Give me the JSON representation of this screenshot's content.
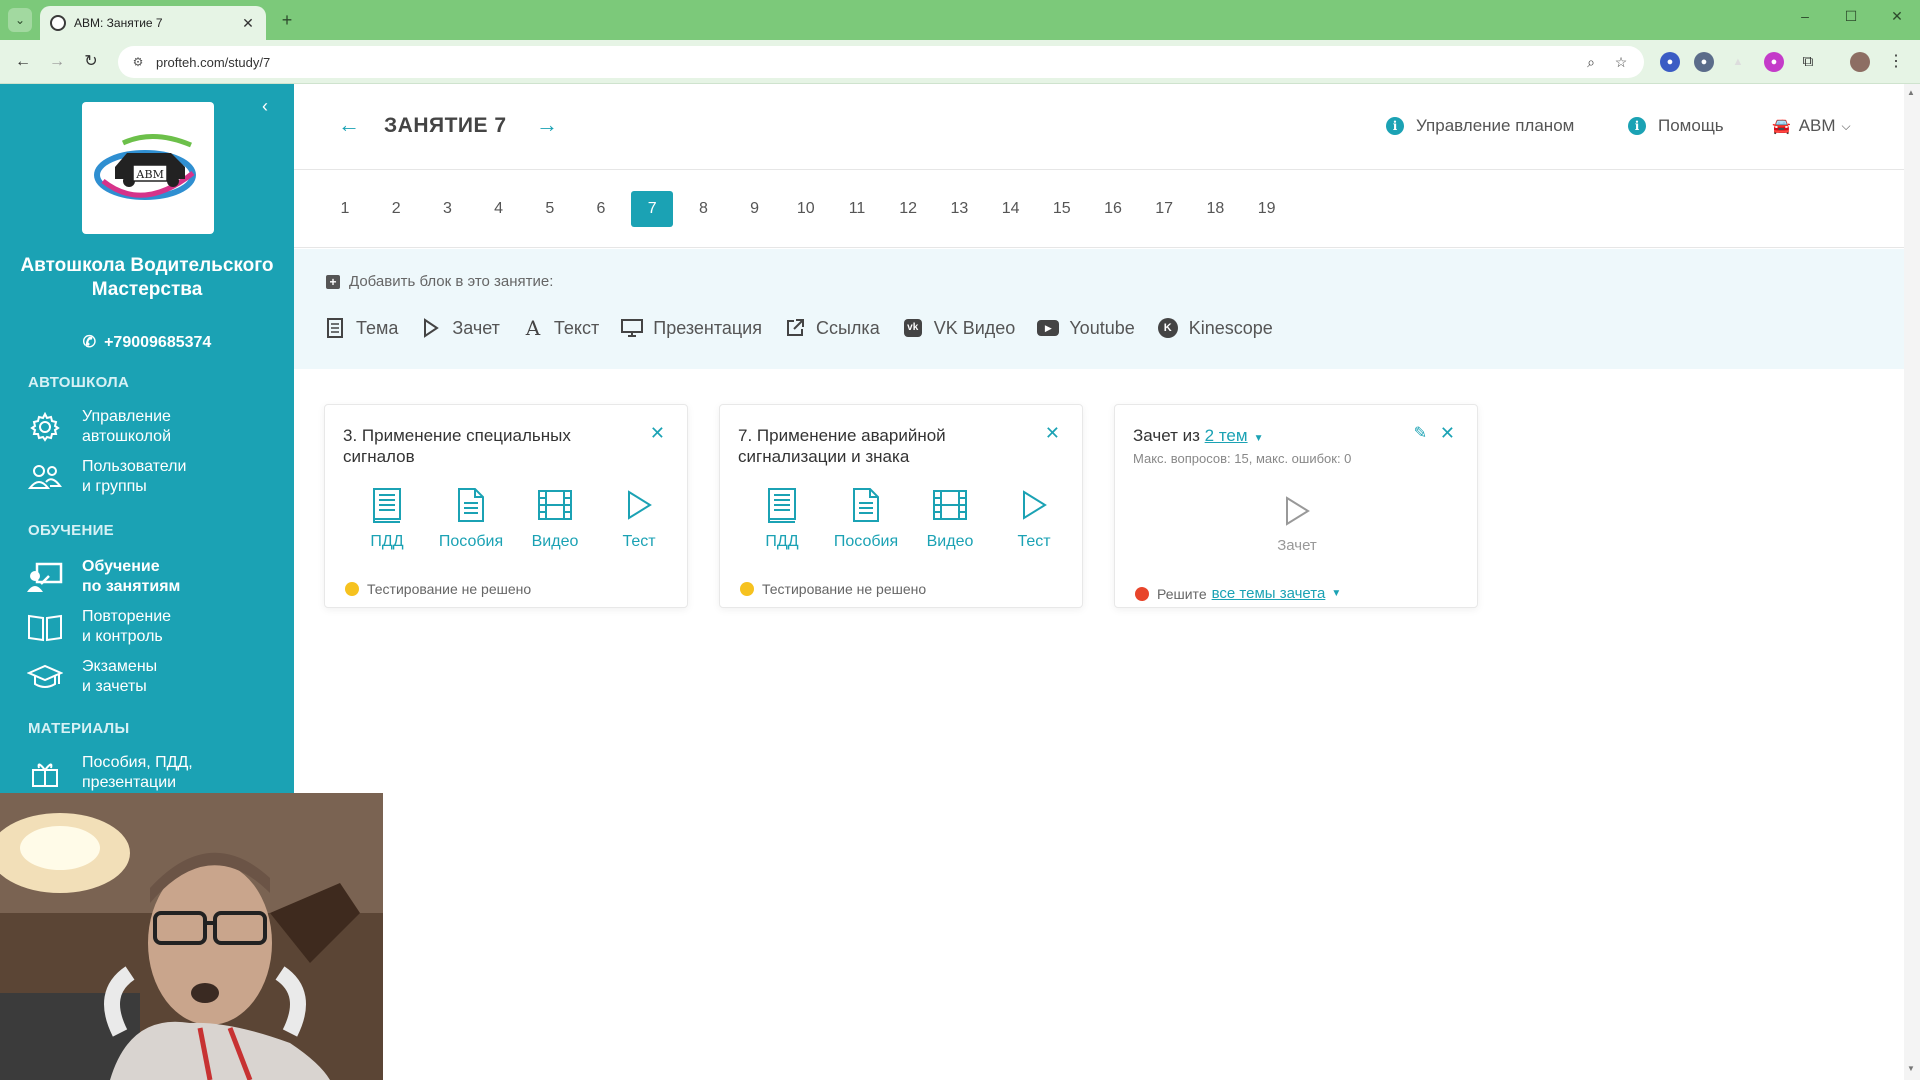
{
  "browser": {
    "tab_title": "АВМ: Занятие 7",
    "url": "profteh.com/study/7"
  },
  "sidebar": {
    "school_name": "Автошкола Водительского Мастерства",
    "phone": "+79009685374",
    "logo_text": "АВМ",
    "sections": {
      "school": "АВТОШКОЛА",
      "learning": "ОБУЧЕНИЕ",
      "materials": "МАТЕРИАЛЫ"
    },
    "items": [
      {
        "label": "Управление\nавтошколой",
        "icon": "gear-icon"
      },
      {
        "label": "Пользователи\nи группы",
        "icon": "users-icon"
      },
      {
        "label": "Обучение\nпо занятиям",
        "icon": "teacher-icon",
        "active": true
      },
      {
        "label": "Повторение\nи контроль",
        "icon": "book-open-icon"
      },
      {
        "label": "Экзамены\nи зачеты",
        "icon": "graduation-cap-icon"
      },
      {
        "label": "Пособия, ПДД,\nпрезентации",
        "icon": "box-icon"
      }
    ]
  },
  "header": {
    "title": "ЗАНЯТИЕ 7",
    "manage_plan": "Управление планом",
    "help": "Помощь",
    "user": "АВМ"
  },
  "lessons": {
    "numbers": [
      "1",
      "2",
      "3",
      "4",
      "5",
      "6",
      "7",
      "8",
      "9",
      "10",
      "11",
      "12",
      "13",
      "14",
      "15",
      "16",
      "17",
      "18",
      "19"
    ],
    "active": "7"
  },
  "add_block": {
    "title": "Добавить блок в это занятие:",
    "options": [
      {
        "label": "Тема",
        "icon": "document-icon"
      },
      {
        "label": "Зачет",
        "icon": "play-icon"
      },
      {
        "label": "Текст",
        "icon": "text-icon"
      },
      {
        "label": "Презентация",
        "icon": "presentation-icon"
      },
      {
        "label": "Ссылка",
        "icon": "external-link-icon"
      },
      {
        "label": "VK Видео",
        "icon": "vk-icon"
      },
      {
        "label": "Youtube",
        "icon": "youtube-icon"
      },
      {
        "label": "Kinescope",
        "icon": "kinescope-icon"
      }
    ]
  },
  "cards": [
    {
      "title": "3. Применение специальных сигналов",
      "actions": [
        "ПДД",
        "Пособия",
        "Видео",
        "Тест"
      ],
      "status": "Тестирование не решено",
      "status_color": "#f6c21f"
    },
    {
      "title": "7. Применение аварийной сигнализации и знака",
      "actions": [
        "ПДД",
        "Пособия",
        "Видео",
        "Тест"
      ],
      "status": "Тестирование не решено",
      "status_color": "#f6c21f"
    },
    {
      "title_prefix": "Зачет из",
      "title_link": "2 тем",
      "subtitle": "Макс. вопросов: 15, макс. ошибок: 0",
      "action": "Зачет",
      "status_prefix": "Решите",
      "status_link": "все темы зачета",
      "status_color": "#e8452b"
    }
  ],
  "colors": {
    "accent": "#1ba2b4",
    "sidebar_bg": "#1ba2b4",
    "panel_bg": "#eef8fb",
    "browser_frame": "#7cc97a"
  }
}
